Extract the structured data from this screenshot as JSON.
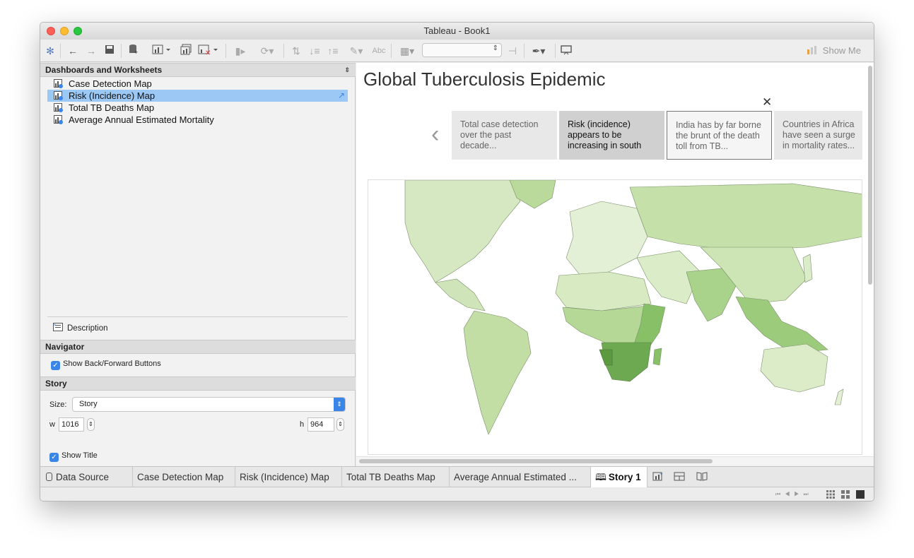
{
  "window": {
    "title": "Tableau - Book1"
  },
  "toolbar": {
    "show_me": "Show Me",
    "abc": "Abc"
  },
  "sidebar": {
    "header": "Dashboards and Worksheets",
    "sheets": [
      {
        "label": "Case Detection Map"
      },
      {
        "label": "Risk (Incidence) Map"
      },
      {
        "label": "Total TB Deaths Map"
      },
      {
        "label": "Average Annual Estimated Mortality"
      }
    ],
    "description": "Description"
  },
  "navigator": {
    "header": "Navigator",
    "show_buttons": "Show Back/Forward Buttons"
  },
  "story_panel": {
    "header": "Story",
    "size_label": "Size:",
    "size_value": "Story",
    "w_label": "w",
    "w_value": "1016",
    "h_label": "h",
    "h_value": "964",
    "show_title": "Show Title"
  },
  "story": {
    "title": "Global Tuberculosis Epidemic",
    "cards": [
      {
        "text": "Total case detection over the past decade..."
      },
      {
        "text": "Risk (incidence) appears to be increasing in south"
      },
      {
        "text": "India has by far borne the brunt of the death toll from TB..."
      },
      {
        "text": "Countries in Africa have seen a surge in mortality rates..."
      }
    ]
  },
  "tabs": {
    "data_source": "Data Source",
    "items": [
      {
        "label": "Case Detection Map"
      },
      {
        "label": "Risk (Incidence) Map"
      },
      {
        "label": "Total TB Deaths Map"
      },
      {
        "label": "Average Annual Estimated ..."
      },
      {
        "label": "Story 1"
      }
    ]
  },
  "colors": {
    "selection": "#9cc8f5",
    "accent": "#3a85e8",
    "map_light": "#d3e7bd",
    "map_dark": "#5c9a40"
  }
}
